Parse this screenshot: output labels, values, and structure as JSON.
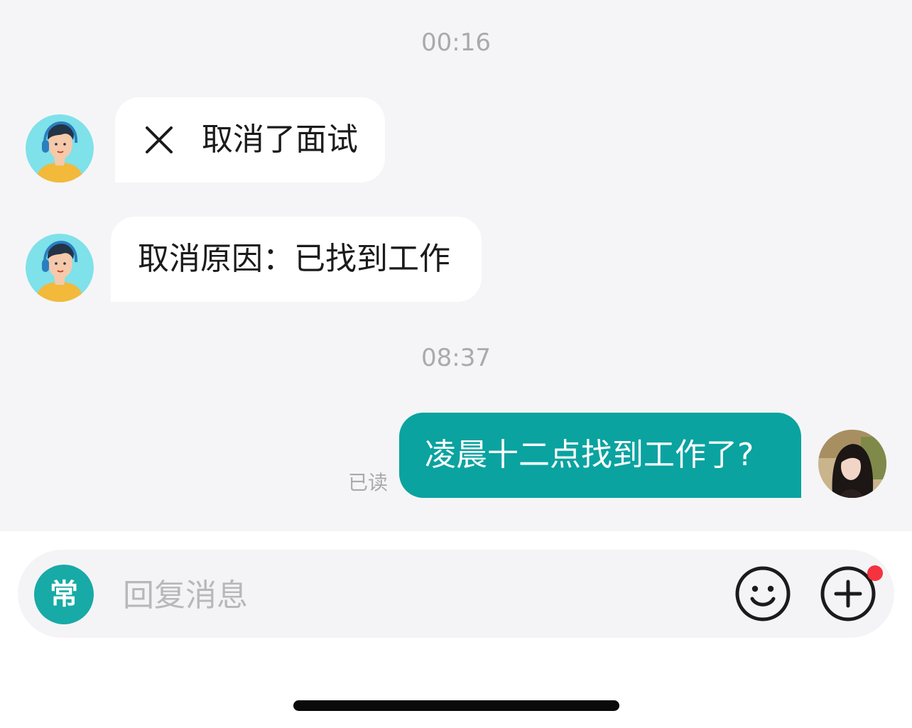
{
  "messages": {
    "timestamp_1": "00:16",
    "recruiter_event": "取消了面试",
    "recruiter_reason": "取消原因：已找到工作",
    "timestamp_2": "08:37",
    "my_message": "凌晨十二点找到工作了?",
    "read_status": "已读"
  },
  "icons": {
    "event_icon": "close-icon",
    "emoji_button": "smiley-icon",
    "more_button": "plus-circle-icon"
  },
  "input_bar": {
    "common_phrases_label": "常",
    "placeholder": "回复消息",
    "value": ""
  },
  "colors": {
    "accent": "#0aa3a0",
    "notification_dot": "#f5333f",
    "chat_background": "#f5f5f7"
  }
}
